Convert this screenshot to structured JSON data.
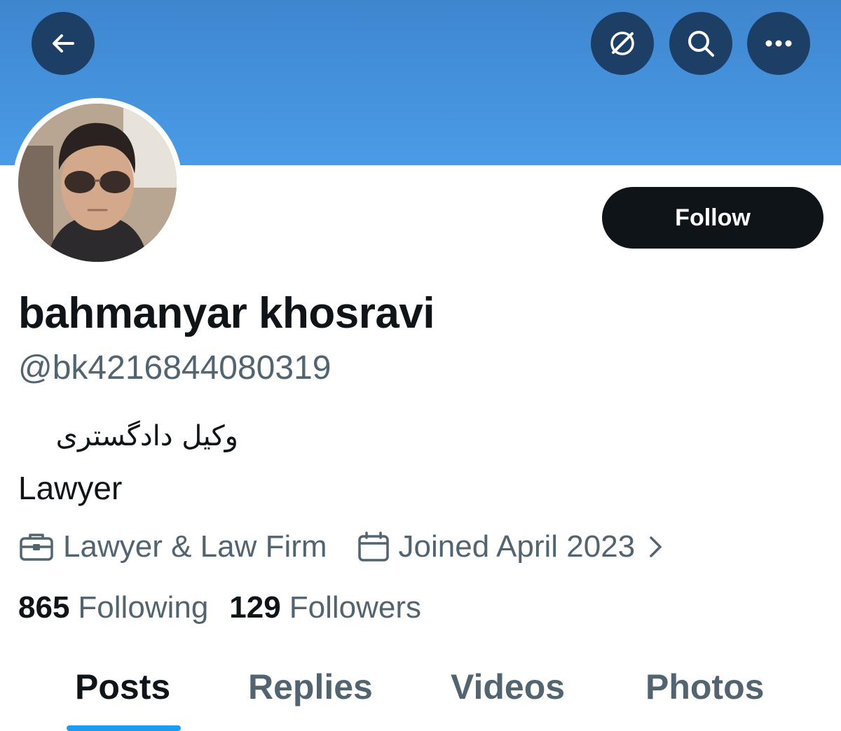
{
  "profile": {
    "display_name": "bahmanyar khosravi",
    "handle": "@bk4216844080319",
    "bio_farsi": "وکیل دادگستری",
    "bio_english": "Lawyer",
    "category": "Lawyer & Law Firm",
    "joined": "Joined April 2023"
  },
  "actions": {
    "follow_label": "Follow"
  },
  "stats": {
    "following_count": "865",
    "following_label": "Following",
    "followers_count": "129",
    "followers_label": "Followers"
  },
  "tabs": [
    {
      "label": "Posts",
      "active": true
    },
    {
      "label": "Replies",
      "active": false
    },
    {
      "label": "Videos",
      "active": false
    },
    {
      "label": "Photos",
      "active": false
    }
  ],
  "icons": {
    "back": "arrow-left-icon",
    "grok": "grok-icon",
    "search": "search-icon",
    "more": "more-horizontal-icon",
    "category": "briefcase-icon",
    "joined": "calendar-icon",
    "joined_chevron": "chevron-right-icon"
  },
  "colors": {
    "banner": "#4a9be6",
    "accent": "#1d9bf0",
    "primary_text": "#0f1419",
    "secondary_text": "#536471",
    "follow_button": "#0f1419"
  }
}
